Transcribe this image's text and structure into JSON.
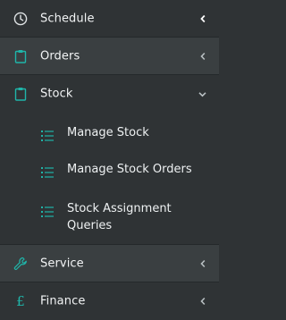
{
  "menu": {
    "items": [
      {
        "label": "Schedule",
        "icon": "clock-icon"
      },
      {
        "label": "Orders",
        "icon": "clipboard-icon"
      },
      {
        "label": "Stock",
        "icon": "clipboard-icon"
      },
      {
        "label": "Service",
        "icon": "wrench-icon"
      },
      {
        "label": "Finance",
        "icon": "pound-icon"
      }
    ],
    "stock_submenu": [
      {
        "label": "Manage Stock",
        "icon": "list-icon"
      },
      {
        "label": "Manage Stock Orders",
        "icon": "list-icon"
      },
      {
        "label": "Stock Assignment Queries",
        "icon": "list-icon"
      }
    ]
  },
  "colors": {
    "background": "#2f3335",
    "accent": "#1fb5a9",
    "text": "#f2f4f5"
  }
}
